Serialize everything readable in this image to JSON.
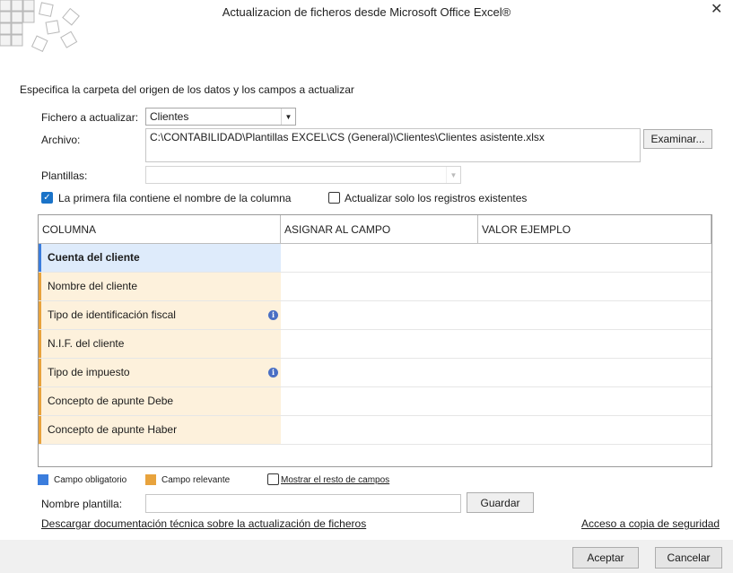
{
  "window": {
    "title": "Actualizacion de ficheros desde Microsoft Office Excel®",
    "close_glyph": "✕"
  },
  "instructions": "Especifica la carpeta del origen de los datos y los campos a actualizar",
  "form": {
    "fichero_label": "Fichero a actualizar:",
    "fichero_value": "Clientes",
    "archivo_label": "Archivo:",
    "archivo_value": "C:\\CONTABILIDAD\\Plantillas EXCEL\\CS (General)\\Clientes\\Clientes asistente.xlsx",
    "examinar_label": "Examinar...",
    "plantillas_label": "Plantillas:",
    "plantillas_value": ""
  },
  "options": {
    "primera_fila_label": "La primera fila contiene el nombre de la columna",
    "primera_fila_checked": true,
    "actualizar_existentes_label": "Actualizar solo los registros existentes",
    "actualizar_existentes_checked": false
  },
  "grid": {
    "headers": [
      "COLUMNA",
      "ASIGNAR AL CAMPO",
      "VALOR EJEMPLO"
    ],
    "rows": [
      {
        "columna": "Cuenta del cliente",
        "type": "obligatorio",
        "info": false
      },
      {
        "columna": "Nombre del cliente",
        "type": "relevante",
        "info": false
      },
      {
        "columna": "Tipo de identificación fiscal",
        "type": "relevante",
        "info": true
      },
      {
        "columna": "N.I.F. del cliente",
        "type": "relevante",
        "info": false
      },
      {
        "columna": "Tipo de impuesto",
        "type": "relevante",
        "info": true
      },
      {
        "columna": "Concepto de apunte Debe",
        "type": "relevante",
        "info": false
      },
      {
        "columna": "Concepto de apunte Haber",
        "type": "relevante",
        "info": false
      }
    ]
  },
  "legend": {
    "obligatorio_label": "Campo obligatorio",
    "obligatorio_color": "#3b7ddd",
    "relevante_label": "Campo relevante",
    "relevante_color": "#e8a33d",
    "mostrar_resto_label": "Mostrar el resto de campos",
    "mostrar_resto_checked": false
  },
  "plantilla": {
    "nombre_label": "Nombre plantilla:",
    "nombre_value": "",
    "guardar_label": "Guardar"
  },
  "links": {
    "descargar": "Descargar documentación técnica sobre la actualización de ficheros",
    "copia": "Acceso a copia de seguridad"
  },
  "footer": {
    "aceptar_label": "Aceptar",
    "cancelar_label": "Cancelar"
  }
}
